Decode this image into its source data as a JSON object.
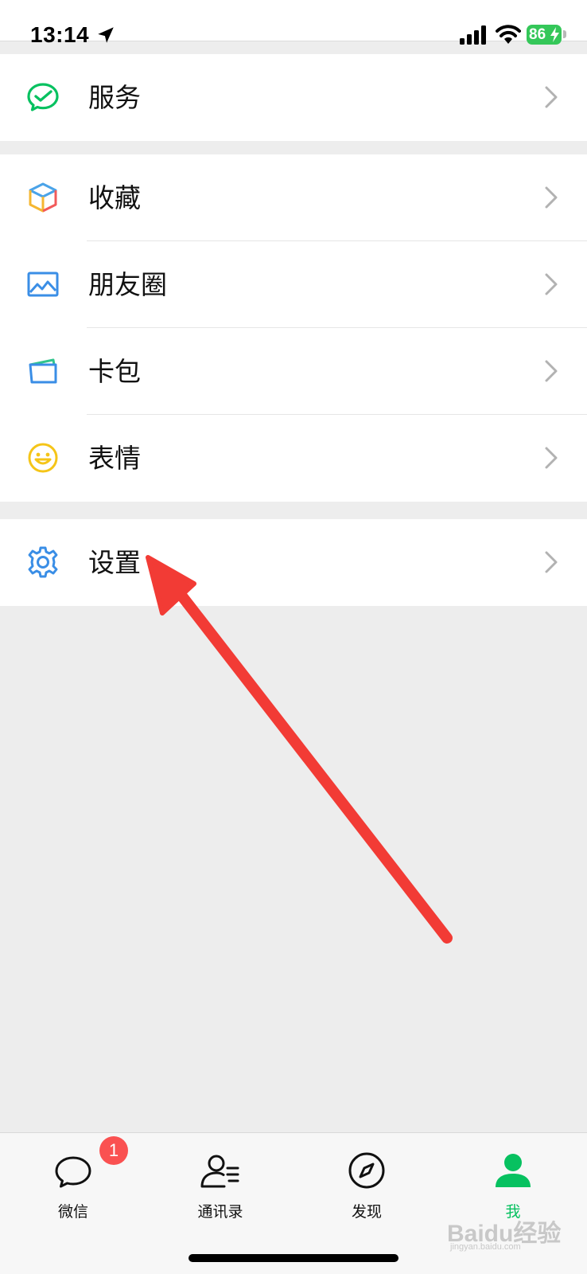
{
  "status_bar": {
    "time": "13:14",
    "battery": "86",
    "icons": [
      "location-arrow-icon",
      "cellular-signal-icon",
      "wifi-icon",
      "battery-icon"
    ]
  },
  "menu": {
    "service": {
      "label": "服务",
      "icon": "wechat-pay-check-icon"
    },
    "favorites": {
      "label": "收藏",
      "icon": "cube-icon"
    },
    "moments": {
      "label": "朋友圈",
      "icon": "picture-icon"
    },
    "cards": {
      "label": "卡包",
      "icon": "card-wallet-icon"
    },
    "stickers": {
      "label": "表情",
      "icon": "smiley-icon"
    },
    "settings": {
      "label": "设置",
      "icon": "gear-icon"
    }
  },
  "tabbar": {
    "items": [
      {
        "label": "微信",
        "icon": "chat-bubble-icon",
        "badge": "1"
      },
      {
        "label": "通讯录",
        "icon": "contacts-icon"
      },
      {
        "label": "发现",
        "icon": "compass-icon"
      },
      {
        "label": "我",
        "icon": "person-icon",
        "active": true
      }
    ]
  },
  "watermark": {
    "text": "Baidu经验",
    "sub": "jingyan.baidu.com"
  },
  "colors": {
    "accent_green": "#07c160",
    "annotation_red": "#f23b35",
    "badge_red": "#fa5151",
    "background": "#ededed"
  }
}
